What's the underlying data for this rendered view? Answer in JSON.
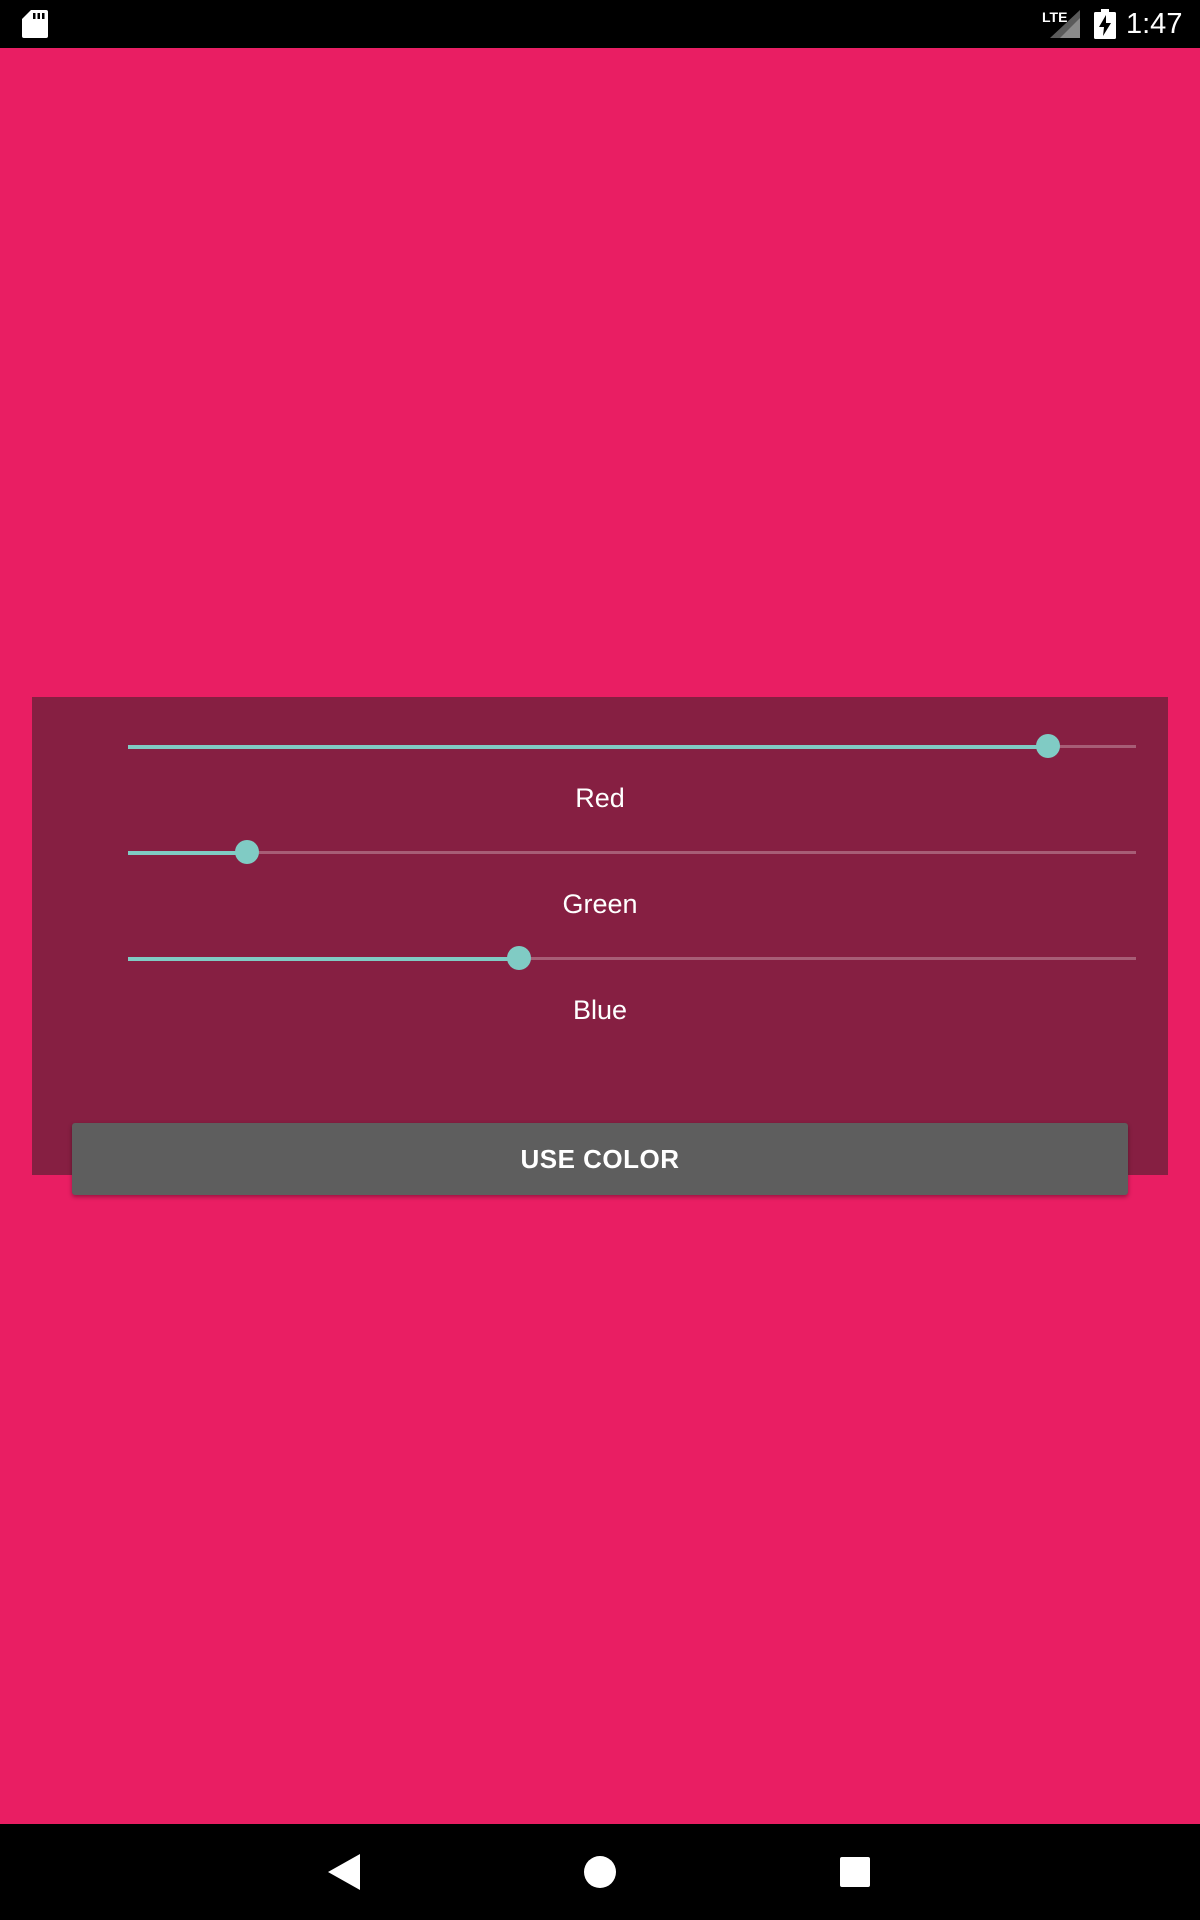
{
  "status_bar": {
    "network_label": "LTE",
    "time": "1:47",
    "icons": [
      "sd-card-icon",
      "signal-icon",
      "battery-charging-icon"
    ]
  },
  "colors": {
    "background": "#E91E63",
    "panel": "#861F42",
    "slider_accent": "#80CBC4",
    "button": "#5E5E5E"
  },
  "sliders": [
    {
      "label": "Red",
      "value_fraction": 0.913
    },
    {
      "label": "Green",
      "value_fraction": 0.118
    },
    {
      "label": "Blue",
      "value_fraction": 0.388
    }
  ],
  "button": {
    "label": "USE COLOR"
  },
  "nav_bar": {
    "icons": [
      "back-icon",
      "home-icon",
      "recents-icon"
    ]
  }
}
